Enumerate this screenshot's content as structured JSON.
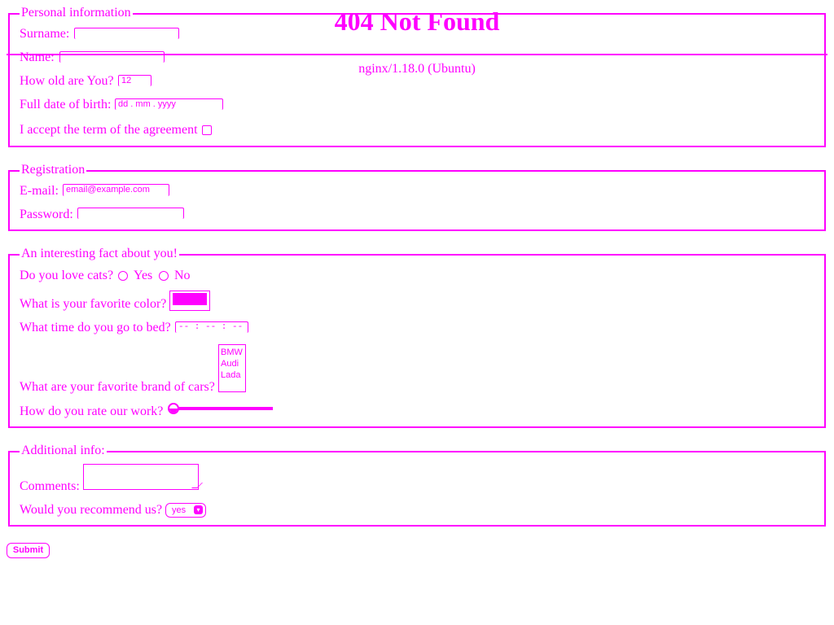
{
  "error_page": {
    "title": "404 Not Found",
    "server": "nginx/1.18.0 (Ubuntu)"
  },
  "personal": {
    "legend": "Personal information",
    "surname_label": "Surname:",
    "name_label": "Name:",
    "age_label": "How old are You?",
    "age_value": "12",
    "dob_label": "Full date of birth:",
    "dob_placeholder": "dd . mm . yyyy",
    "agreement_label": "I accept the term of the agreement"
  },
  "registration": {
    "legend": "Registration",
    "email_label": "E-mail:",
    "email_placeholder": "email@example.com",
    "password_label": "Password:"
  },
  "fact": {
    "legend": "An interesting fact about you!",
    "cats_label": "Do you love cats?",
    "yes_label": "Yes",
    "no_label": "No",
    "color_label": "What is your favorite color?",
    "color_value": "#ff00ff",
    "bedtime_label": "What time do you go to bed?",
    "bedtime_placeholder": "-- : -- : --",
    "cars_label": "What are your favorite brand of cars?",
    "cars_options": [
      "BMW",
      "Audi",
      "Lada"
    ],
    "rating_label": "How do you rate our work?",
    "rating_value": 0
  },
  "additional": {
    "legend": "Additional info:",
    "comments_label": "Comments:",
    "recommend_label": "Would you recommend us?",
    "recommend_value": "yes"
  },
  "submit_label": "Submit",
  "colors": {
    "foreground": "#ff00ff",
    "background": "#ffffff"
  }
}
